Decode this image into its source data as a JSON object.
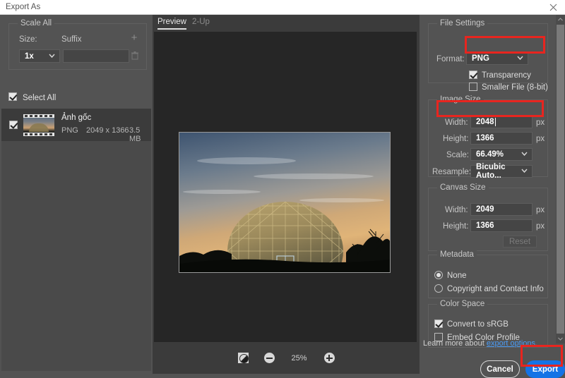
{
  "window": {
    "title": "Export As",
    "close_icon": "close-icon"
  },
  "left_panel": {
    "scale_all": {
      "group_title": "Scale All",
      "size_label": "Size:",
      "suffix_label": "Suffix",
      "size_value": "1x",
      "suffix_value": "",
      "add_icon": "plus-icon",
      "delete_icon": "trash-icon"
    },
    "select_all_label": "Select All",
    "select_all_checked": true,
    "files": [
      {
        "name": "Ảnh gốc",
        "format": "PNG",
        "dimensions": "2049 x 1366",
        "size": "3.5 MB",
        "checked": true
      }
    ]
  },
  "preview": {
    "tabs": [
      {
        "label": "Preview",
        "active": true
      },
      {
        "label": "2-Up",
        "active": false
      }
    ],
    "zoom_level": "25%",
    "background_toggle_icon": "transparency-toggle-icon",
    "zoom_out_icon": "minus-circle-icon",
    "zoom_in_icon": "plus-circle-icon",
    "image_alt": "geodesic-dome-at-sunset"
  },
  "right_panel": {
    "file_settings": {
      "group_title": "File Settings",
      "format_label": "Format:",
      "format_value": "PNG",
      "transparency_label": "Transparency",
      "transparency_checked": true,
      "smaller_file_label": "Smaller File (8-bit)",
      "smaller_file_checked": false
    },
    "image_size": {
      "group_title": "Image Size",
      "width_label": "Width:",
      "width_value": "2048",
      "width_unit": "px",
      "height_label": "Height:",
      "height_value": "1366",
      "height_unit": "px",
      "scale_label": "Scale:",
      "scale_value": "66.49%",
      "resample_label": "Resample:",
      "resample_value": "Bicubic Auto..."
    },
    "canvas_size": {
      "group_title": "Canvas Size",
      "width_label": "Width:",
      "width_value": "2049",
      "width_unit": "px",
      "height_label": "Height:",
      "height_value": "1366",
      "height_unit": "px",
      "reset_label": "Reset"
    },
    "metadata": {
      "group_title": "Metadata",
      "none_label": "None",
      "none_selected": true,
      "copyright_label": "Copyright and Contact Info",
      "copyright_selected": false
    },
    "color_space": {
      "group_title": "Color Space",
      "convert_label": "Convert to sRGB",
      "convert_checked": true,
      "embed_label": "Embed Color Profile",
      "embed_checked": false
    },
    "footer": {
      "learn_more_text": "Learn more about",
      "learn_more_link": "export options.",
      "cancel_label": "Cancel",
      "export_label": "Export"
    }
  },
  "colors": {
    "accent_blue": "#1473e6",
    "highlight_red": "#e8251f",
    "panel_bg": "#535353",
    "canvas_bg": "#262626",
    "link_blue": "#4a9bf5"
  }
}
